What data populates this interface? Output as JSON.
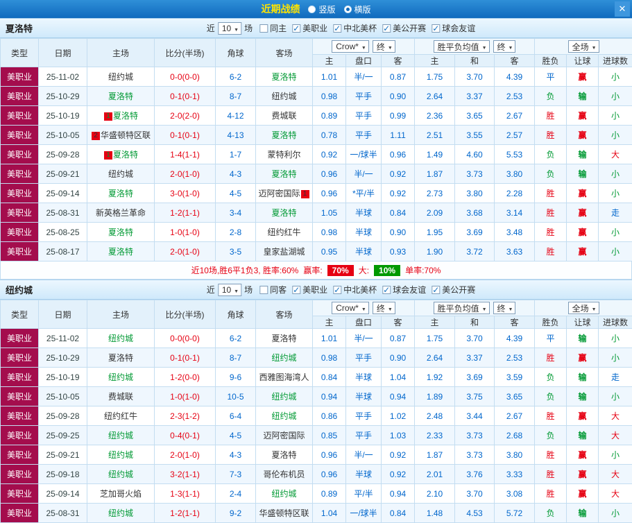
{
  "colors": {
    "topbar_blue": "#0f6abd",
    "league_maroon": "#a40d4d",
    "focus_team_green": "#009933",
    "score_red": "#e60012",
    "odds_blue": "#0066cc"
  },
  "topbar": {
    "title": "近期战绩",
    "radios": [
      {
        "label": "竖版",
        "selected": false
      },
      {
        "label": "横版",
        "selected": true
      }
    ],
    "close_icon": "✕"
  },
  "columns": {
    "type": "类型",
    "date": "日期",
    "home": "主场",
    "score": "比分(半场)",
    "corner": "角球",
    "away": "客场",
    "odds_home": "主",
    "odds_handicap": "盘口",
    "odds_away": "客",
    "avg_home": "主",
    "avg_draw": "和",
    "avg_away": "客",
    "result": "胜负",
    "handicap": "让球",
    "goals": "进球数"
  },
  "sections": [
    {
      "team": "夏洛特",
      "filter": {
        "near_label": "近",
        "count": "10",
        "games_label": "场",
        "checkboxes": [
          {
            "label": "同主",
            "checked": false
          },
          {
            "label": "美职业",
            "checked": true
          },
          {
            "label": "中北美杯",
            "checked": true
          },
          {
            "label": "美公开赛",
            "checked": true
          },
          {
            "label": "球会友谊",
            "checked": true
          }
        ]
      },
      "selects": {
        "company": "Crow*",
        "final1": "终",
        "avg": "胜平负均值",
        "final2": "终",
        "scope": "全场"
      },
      "rows": [
        {
          "type": "美职业",
          "date": "25-11-02",
          "home": "纽约城",
          "home_cls": "",
          "score": "0-0(0-0)",
          "corner": "6-2",
          "away": "夏洛特",
          "away_cls": "green",
          "o1": "1.01",
          "o2": "半/一",
          "o3": "0.87",
          "a1": "1.75",
          "a2": "3.70",
          "a3": "4.39",
          "res": "平",
          "res_cls": "blue",
          "hr": "赢",
          "hr_cls": "red",
          "g": "小",
          "g_cls": "green"
        },
        {
          "type": "美职业",
          "date": "25-10-29",
          "home": "夏洛特",
          "home_cls": "green",
          "score": "0-1(0-1)",
          "corner": "8-7",
          "away": "纽约城",
          "away_cls": "",
          "o1": "0.98",
          "o2": "平手",
          "o3": "0.90",
          "a1": "2.64",
          "a2": "3.37",
          "a3": "2.53",
          "res": "负",
          "res_cls": "green",
          "hr": "输",
          "hr_cls": "green",
          "g": "小",
          "g_cls": "green"
        },
        {
          "type": "美职业",
          "date": "25-10-19",
          "home": "夏洛特",
          "home_cls": "green",
          "home_badge": "1",
          "score": "2-0(2-0)",
          "corner": "4-12",
          "away": "费城联",
          "away_cls": "",
          "o1": "0.89",
          "o2": "平手",
          "o3": "0.99",
          "a1": "2.36",
          "a2": "3.65",
          "a3": "2.67",
          "res": "胜",
          "res_cls": "red",
          "hr": "赢",
          "hr_cls": "red",
          "g": "小",
          "g_cls": "green"
        },
        {
          "type": "美职业",
          "date": "25-10-05",
          "home": "华盛顿特区联",
          "home_cls": "",
          "home_badge": "2",
          "score": "0-1(0-1)",
          "corner": "4-13",
          "away": "夏洛特",
          "away_cls": "green",
          "o1": "0.78",
          "o2": "平手",
          "o3": "1.11",
          "a1": "2.51",
          "a2": "3.55",
          "a3": "2.57",
          "res": "胜",
          "res_cls": "red",
          "hr": "赢",
          "hr_cls": "red",
          "g": "小",
          "g_cls": "green"
        },
        {
          "type": "美职业",
          "date": "25-09-28",
          "home": "夏洛特",
          "home_cls": "green",
          "home_badge": "1",
          "score": "1-4(1-1)",
          "corner": "1-7",
          "away": "蒙特利尔",
          "away_cls": "",
          "o1": "0.92",
          "o2": "一/球半",
          "o3": "0.96",
          "a1": "1.49",
          "a2": "4.60",
          "a3": "5.53",
          "res": "负",
          "res_cls": "green",
          "hr": "输",
          "hr_cls": "green",
          "g": "大",
          "g_cls": "red"
        },
        {
          "type": "美职业",
          "date": "25-09-21",
          "home": "纽约城",
          "home_cls": "",
          "score": "2-0(1-0)",
          "corner": "4-3",
          "away": "夏洛特",
          "away_cls": "green",
          "o1": "0.96",
          "o2": "半/一",
          "o3": "0.92",
          "a1": "1.87",
          "a2": "3.73",
          "a3": "3.80",
          "res": "负",
          "res_cls": "green",
          "hr": "输",
          "hr_cls": "green",
          "g": "小",
          "g_cls": "green"
        },
        {
          "type": "美职业",
          "date": "25-09-14",
          "home": "夏洛特",
          "home_cls": "green",
          "score": "3-0(1-0)",
          "corner": "4-5",
          "away": "迈阿密国际",
          "away_cls": "",
          "away_badge": "1",
          "o1": "0.96",
          "o2": "*平/半",
          "o3": "0.92",
          "a1": "2.73",
          "a2": "3.80",
          "a3": "2.28",
          "res": "胜",
          "res_cls": "red",
          "hr": "赢",
          "hr_cls": "red",
          "g": "小",
          "g_cls": "green"
        },
        {
          "type": "美职业",
          "date": "25-08-31",
          "home": "新英格兰革命",
          "home_cls": "",
          "score": "1-2(1-1)",
          "corner": "3-4",
          "away": "夏洛特",
          "away_cls": "green",
          "o1": "1.05",
          "o2": "半球",
          "o3": "0.84",
          "a1": "2.09",
          "a2": "3.68",
          "a3": "3.14",
          "res": "胜",
          "res_cls": "red",
          "hr": "赢",
          "hr_cls": "red",
          "g": "走",
          "g_cls": "blue"
        },
        {
          "type": "美职业",
          "date": "25-08-25",
          "home": "夏洛特",
          "home_cls": "green",
          "score": "1-0(1-0)",
          "corner": "2-8",
          "away": "纽约红牛",
          "away_cls": "",
          "o1": "0.98",
          "o2": "半球",
          "o3": "0.90",
          "a1": "1.95",
          "a2": "3.69",
          "a3": "3.48",
          "res": "胜",
          "res_cls": "red",
          "hr": "赢",
          "hr_cls": "red",
          "g": "小",
          "g_cls": "green"
        },
        {
          "type": "美职业",
          "date": "25-08-17",
          "home": "夏洛特",
          "home_cls": "green",
          "score": "2-0(1-0)",
          "corner": "3-5",
          "away": "皇家盐湖城",
          "away_cls": "",
          "o1": "0.95",
          "o2": "半球",
          "o3": "0.93",
          "a1": "1.90",
          "a2": "3.72",
          "a3": "3.63",
          "res": "胜",
          "res_cls": "red",
          "hr": "赢",
          "hr_cls": "red",
          "g": "小",
          "g_cls": "green"
        }
      ],
      "summary": {
        "text": "近10场,胜6平1负3, 胜率:60%",
        "win_label": "赢率:",
        "win_rate": "70%",
        "big_label": "大:",
        "big_rate": "10%",
        "single": "单率:70%"
      }
    },
    {
      "team": "纽约城",
      "filter": {
        "near_label": "近",
        "count": "10",
        "games_label": "场",
        "checkboxes": [
          {
            "label": "同客",
            "checked": false
          },
          {
            "label": "美职业",
            "checked": true
          },
          {
            "label": "中北美杯",
            "checked": true
          },
          {
            "label": "球会友谊",
            "checked": true
          },
          {
            "label": "美公开赛",
            "checked": true
          }
        ]
      },
      "selects": {
        "company": "Crow*",
        "final1": "终",
        "avg": "胜平负均值",
        "final2": "终",
        "scope": "全场"
      },
      "rows": [
        {
          "type": "美职业",
          "date": "25-11-02",
          "home": "纽约城",
          "home_cls": "green",
          "score": "0-0(0-0)",
          "corner": "6-2",
          "away": "夏洛特",
          "away_cls": "",
          "o1": "1.01",
          "o2": "半/一",
          "o3": "0.87",
          "a1": "1.75",
          "a2": "3.70",
          "a3": "4.39",
          "res": "平",
          "res_cls": "blue",
          "hr": "输",
          "hr_cls": "green",
          "g": "小",
          "g_cls": "green"
        },
        {
          "type": "美职业",
          "date": "25-10-29",
          "home": "夏洛特",
          "home_cls": "",
          "score": "0-1(0-1)",
          "corner": "8-7",
          "away": "纽约城",
          "away_cls": "green",
          "o1": "0.98",
          "o2": "平手",
          "o3": "0.90",
          "a1": "2.64",
          "a2": "3.37",
          "a3": "2.53",
          "res": "胜",
          "res_cls": "red",
          "hr": "赢",
          "hr_cls": "red",
          "g": "小",
          "g_cls": "green"
        },
        {
          "type": "美职业",
          "date": "25-10-19",
          "home": "纽约城",
          "home_cls": "green",
          "score": "1-2(0-0)",
          "corner": "9-6",
          "away": "西雅图海湾人",
          "away_cls": "",
          "o1": "0.84",
          "o2": "半球",
          "o3": "1.04",
          "a1": "1.92",
          "a2": "3.69",
          "a3": "3.59",
          "res": "负",
          "res_cls": "green",
          "hr": "输",
          "hr_cls": "green",
          "g": "走",
          "g_cls": "blue"
        },
        {
          "type": "美职业",
          "date": "25-10-05",
          "home": "费城联",
          "home_cls": "",
          "score": "1-0(1-0)",
          "corner": "10-5",
          "away": "纽约城",
          "away_cls": "green",
          "o1": "0.94",
          "o2": "半球",
          "o3": "0.94",
          "a1": "1.89",
          "a2": "3.75",
          "a3": "3.65",
          "res": "负",
          "res_cls": "green",
          "hr": "输",
          "hr_cls": "green",
          "g": "小",
          "g_cls": "green"
        },
        {
          "type": "美职业",
          "date": "25-09-28",
          "home": "纽约红牛",
          "home_cls": "",
          "score": "2-3(1-2)",
          "corner": "6-4",
          "away": "纽约城",
          "away_cls": "green",
          "o1": "0.86",
          "o2": "平手",
          "o3": "1.02",
          "a1": "2.48",
          "a2": "3.44",
          "a3": "2.67",
          "res": "胜",
          "res_cls": "red",
          "hr": "赢",
          "hr_cls": "red",
          "g": "大",
          "g_cls": "red"
        },
        {
          "type": "美职业",
          "date": "25-09-25",
          "home": "纽约城",
          "home_cls": "green",
          "score": "0-4(0-1)",
          "corner": "4-5",
          "away": "迈阿密国际",
          "away_cls": "",
          "o1": "0.85",
          "o2": "平手",
          "o3": "1.03",
          "a1": "2.33",
          "a2": "3.73",
          "a3": "2.68",
          "res": "负",
          "res_cls": "green",
          "hr": "输",
          "hr_cls": "green",
          "g": "大",
          "g_cls": "red"
        },
        {
          "type": "美职业",
          "date": "25-09-21",
          "home": "纽约城",
          "home_cls": "green",
          "score": "2-0(1-0)",
          "corner": "4-3",
          "away": "夏洛特",
          "away_cls": "",
          "o1": "0.96",
          "o2": "半/一",
          "o3": "0.92",
          "a1": "1.87",
          "a2": "3.73",
          "a3": "3.80",
          "res": "胜",
          "res_cls": "red",
          "hr": "赢",
          "hr_cls": "red",
          "g": "小",
          "g_cls": "green"
        },
        {
          "type": "美职业",
          "date": "25-09-18",
          "home": "纽约城",
          "home_cls": "green",
          "score": "3-2(1-1)",
          "corner": "7-3",
          "away": "哥伦布机员",
          "away_cls": "",
          "o1": "0.96",
          "o2": "半球",
          "o3": "0.92",
          "a1": "2.01",
          "a2": "3.76",
          "a3": "3.33",
          "res": "胜",
          "res_cls": "red",
          "hr": "赢",
          "hr_cls": "red",
          "g": "大",
          "g_cls": "red"
        },
        {
          "type": "美职业",
          "date": "25-09-14",
          "home": "芝加哥火焰",
          "home_cls": "",
          "score": "1-3(1-1)",
          "corner": "2-4",
          "away": "纽约城",
          "away_cls": "green",
          "o1": "0.89",
          "o2": "平/半",
          "o3": "0.94",
          "a1": "2.10",
          "a2": "3.70",
          "a3": "3.08",
          "res": "胜",
          "res_cls": "red",
          "hr": "赢",
          "hr_cls": "red",
          "g": "大",
          "g_cls": "red"
        },
        {
          "type": "美职业",
          "date": "25-08-31",
          "home": "纽约城",
          "home_cls": "green",
          "score": "1-2(1-1)",
          "corner": "9-2",
          "away": "华盛顿特区联",
          "away_cls": "",
          "o1": "1.04",
          "o2": "一/球半",
          "o3": "0.84",
          "a1": "1.48",
          "a2": "4.53",
          "a3": "5.72",
          "res": "负",
          "res_cls": "green",
          "hr": "输",
          "hr_cls": "green",
          "g": "小",
          "g_cls": "green"
        }
      ],
      "summary": null
    }
  ]
}
